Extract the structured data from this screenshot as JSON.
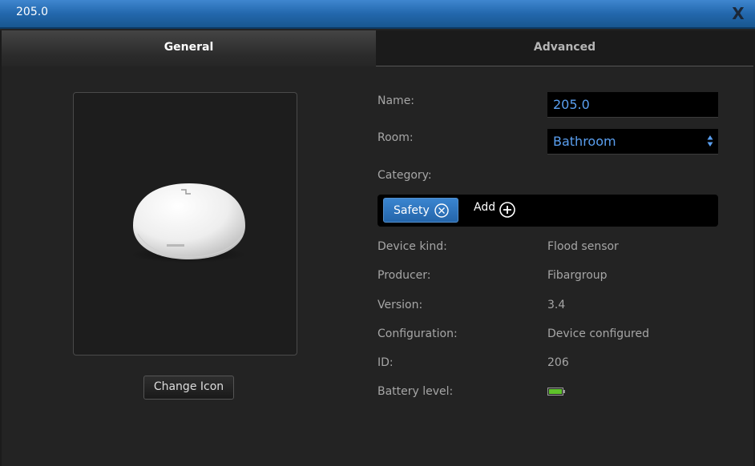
{
  "window": {
    "title": "205.0",
    "close_label": "X"
  },
  "tabs": [
    {
      "label": "General",
      "active": true
    },
    {
      "label": "Advanced",
      "active": false
    }
  ],
  "icon_panel": {
    "device_icon": "flood-sensor-icon",
    "change_icon_label": "Change Icon"
  },
  "form": {
    "name_label": "Name:",
    "name_value": "205.0",
    "room_label": "Room:",
    "room_value": "Bathroom",
    "category_label": "Category:",
    "category_chips": [
      {
        "label": "Safety"
      }
    ],
    "add_label": "Add"
  },
  "info": {
    "device_kind_label": "Device kind:",
    "device_kind_value": "Flood sensor",
    "producer_label": "Producer:",
    "producer_value": "Fibargroup",
    "version_label": "Version:",
    "version_value": "3.4",
    "configuration_label": "Configuration:",
    "configuration_value": "Device configured",
    "id_label": "ID:",
    "id_value": "206",
    "battery_label": "Battery level:",
    "battery_icon": "battery-full-icon"
  },
  "colors": {
    "accent": "#2e74bf",
    "input_text": "#5a9ff0",
    "battery": "#5fc32b"
  }
}
